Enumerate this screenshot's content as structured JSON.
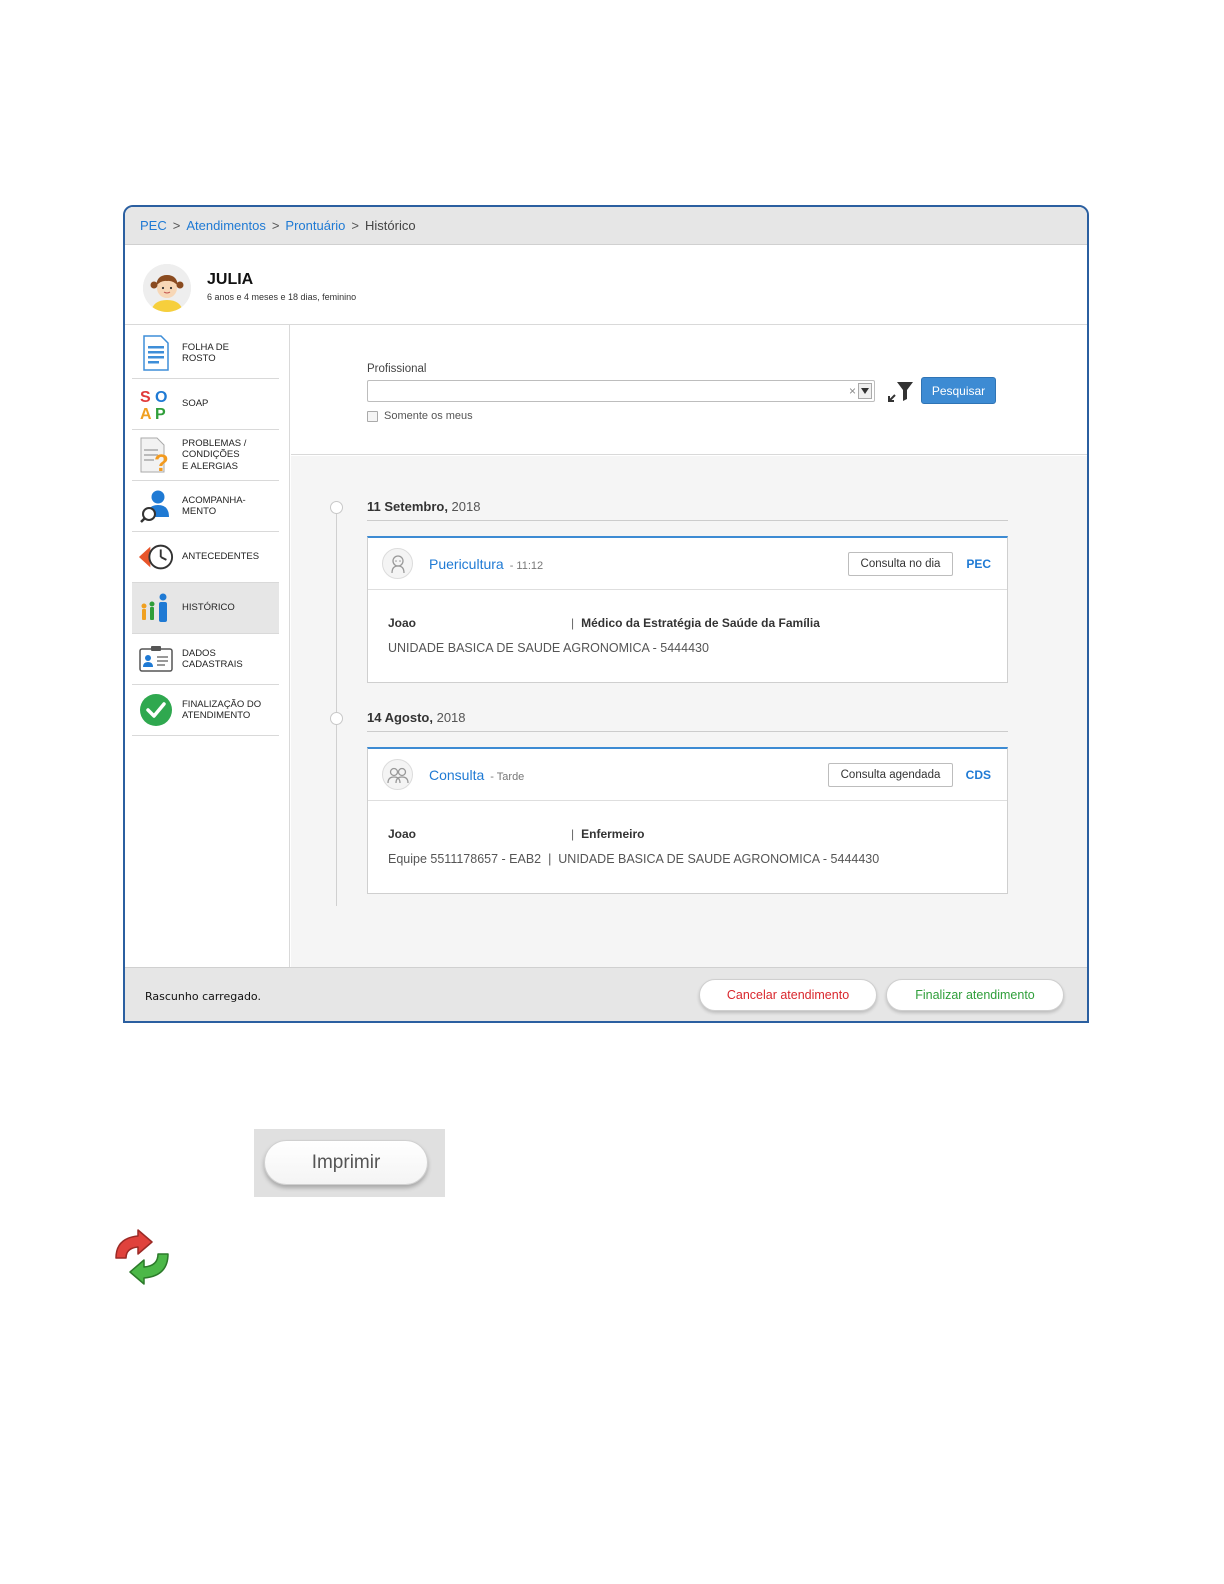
{
  "breadcrumb": {
    "items": [
      "PEC",
      "Atendimentos",
      "Prontuário"
    ],
    "separator": ">",
    "current": "Histórico"
  },
  "patient": {
    "name": "JULIA",
    "info": "6 anos e 4 meses e 18 dias, feminino"
  },
  "sidebar": {
    "items": [
      {
        "label_lines": [
          "FOLHA DE",
          "ROSTO"
        ],
        "icon": "document-icon"
      },
      {
        "label_lines": [
          "SOAP"
        ],
        "icon": "soap-icon"
      },
      {
        "label_lines": [
          "PROBLEMAS /",
          "CONDIÇÕES",
          "E ALERGIAS"
        ],
        "icon": "question-document-icon"
      },
      {
        "label_lines": [
          "ACOMPANHA-",
          "MENTO"
        ],
        "icon": "person-search-icon"
      },
      {
        "label_lines": [
          "ANTECEDENTES"
        ],
        "icon": "clock-back-icon"
      },
      {
        "label_lines": [
          "HISTÓRICO"
        ],
        "icon": "family-icon",
        "active": true
      },
      {
        "label_lines": [
          "DADOS",
          "CADASTRAIS"
        ],
        "icon": "id-card-icon"
      },
      {
        "label_lines": [
          "FINALIZAÇÃO DO",
          "ATENDIMENTO"
        ],
        "icon": "check-circle-icon"
      }
    ]
  },
  "filter": {
    "label": "Profissional",
    "value": "",
    "clear": "×",
    "search_button": "Pesquisar",
    "checkbox_label": "Somente os meus",
    "checkbox_checked": false
  },
  "timeline": [
    {
      "date_bold": "11 Setembro,",
      "year": " 2018",
      "entry": {
        "icon": "baby-icon",
        "title": "Puericultura",
        "subtitle": "- 11:12",
        "tag": "Consulta no dia",
        "origin": "PEC",
        "professional": "Joao",
        "role": "Médico da Estratégia de Saúde da Família",
        "unit": "UNIDADE BASICA DE SAUDE AGRONOMICA - 5444430"
      }
    },
    {
      "date_bold": "14 Agosto,",
      "year": " 2018",
      "entry": {
        "icon": "people-icon",
        "title": "Consulta",
        "subtitle": "- Tarde",
        "tag": "Consulta agendada",
        "origin": "CDS",
        "professional": "Joao",
        "role": "Enfermeiro",
        "unit": "Equipe 5511178657 - EAB2  |  UNIDADE BASICA DE SAUDE AGRONOMICA - 5444430"
      }
    }
  ],
  "footer": {
    "status": "Rascunho carregado.",
    "cancel_label": "Cancelar atendimento",
    "finish_label": "Finalizar atendimento",
    "cancel_color": "#d9272d",
    "finish_color": "#2f9e3a"
  },
  "print_button": "Imprimir",
  "colors": {
    "accent": "#1f7ad4",
    "primary_button": "#3d8bd3",
    "window_border": "#2b5fa0"
  }
}
